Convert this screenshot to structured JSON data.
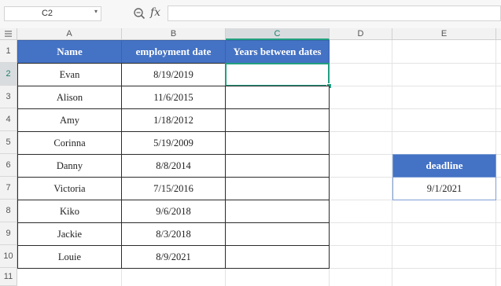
{
  "formula_bar": {
    "name_box": "C2",
    "fx_label": "fx",
    "formula": ""
  },
  "columns": [
    "A",
    "B",
    "C",
    "D",
    "E"
  ],
  "rows": [
    "1",
    "2",
    "3",
    "4",
    "5",
    "6",
    "7",
    "8",
    "9",
    "10",
    "11"
  ],
  "table": {
    "headers": [
      "Name",
      "employment date",
      "Years between dates"
    ],
    "rows": [
      {
        "name": "Evan",
        "date": "8/19/2019",
        "years": ""
      },
      {
        "name": "Alison",
        "date": "11/6/2015",
        "years": ""
      },
      {
        "name": "Amy",
        "date": "1/18/2012",
        "years": ""
      },
      {
        "name": "Corinna",
        "date": "5/19/2009",
        "years": ""
      },
      {
        "name": "Danny",
        "date": "8/8/2014",
        "years": ""
      },
      {
        "name": "Victoria",
        "date": "7/15/2016",
        "years": ""
      },
      {
        "name": "Kiko",
        "date": "9/6/2018",
        "years": ""
      },
      {
        "name": "Jackie",
        "date": "8/3/2018",
        "years": ""
      },
      {
        "name": "Louie",
        "date": "8/9/2021",
        "years": ""
      }
    ]
  },
  "deadline": {
    "label": "deadline",
    "value": "9/1/2021"
  },
  "selection": {
    "cell": "C2",
    "column": "C",
    "row": "2"
  },
  "colors": {
    "header_fill": "#4472c4",
    "selection": "#21a07f"
  }
}
